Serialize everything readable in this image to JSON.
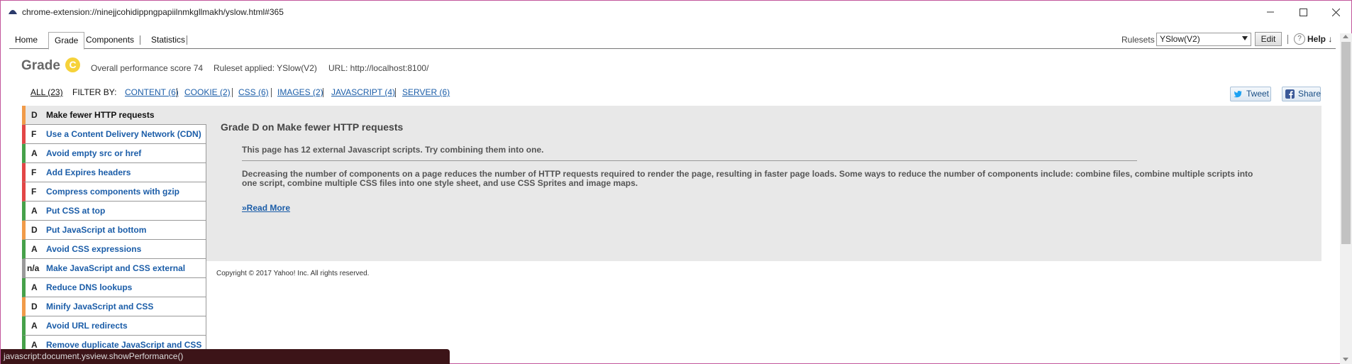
{
  "window": {
    "title": "chrome-extension://ninejjcohidippngpapiilnmkgllmakh/yslow.html#365"
  },
  "tabs": [
    {
      "label": "Home"
    },
    {
      "label": "Grade"
    },
    {
      "label": "Components"
    },
    {
      "label": "Statistics"
    }
  ],
  "toolbar": {
    "rulesets_label": "Rulesets",
    "ruleset_value": "YSlow(V2)",
    "edit_label": "Edit",
    "help_icon": "?",
    "help_label": "Help ↓"
  },
  "grade": {
    "title": "Grade",
    "letter": "C",
    "score_text": "Overall performance score 74",
    "ruleset_text": "Ruleset applied: YSlow(V2)",
    "url_text": "URL: http://localhost:8100/"
  },
  "filters": {
    "all": "ALL (23)",
    "label": "FILTER BY:",
    "items": [
      "CONTENT (6)",
      "COOKIE (2)",
      "CSS (6)",
      "IMAGES (2)",
      "JAVASCRIPT (4)",
      "SERVER (6)"
    ]
  },
  "social": {
    "tweet": "Tweet",
    "share": "Share"
  },
  "rules": [
    {
      "grade": "D",
      "name": "Make fewer HTTP requests",
      "color": "#f19b49"
    },
    {
      "grade": "F",
      "name": "Use a Content Delivery Network (CDN)",
      "color": "#e24646"
    },
    {
      "grade": "A",
      "name": "Avoid empty src or href",
      "color": "#46a14a"
    },
    {
      "grade": "F",
      "name": "Add Expires headers",
      "color": "#e24646"
    },
    {
      "grade": "F",
      "name": "Compress components with gzip",
      "color": "#e24646"
    },
    {
      "grade": "A",
      "name": "Put CSS at top",
      "color": "#46a14a"
    },
    {
      "grade": "D",
      "name": "Put JavaScript at bottom",
      "color": "#f19b49"
    },
    {
      "grade": "A",
      "name": "Avoid CSS expressions",
      "color": "#46a14a"
    },
    {
      "grade": "n/a",
      "name": "Make JavaScript and CSS external",
      "color": "#9a9a9a"
    },
    {
      "grade": "A",
      "name": "Reduce DNS lookups",
      "color": "#46a14a"
    },
    {
      "grade": "D",
      "name": "Minify JavaScript and CSS",
      "color": "#f19b49"
    },
    {
      "grade": "A",
      "name": "Avoid URL redirects",
      "color": "#46a14a"
    },
    {
      "grade": "A",
      "name": "Remove duplicate JavaScript and CSS",
      "color": "#46a14a"
    }
  ],
  "detail": {
    "title": "Grade D on Make fewer HTTP requests",
    "summary": "This page has 12 external Javascript scripts. Try combining them into one.",
    "description": "Decreasing the number of components on a page reduces the number of HTTP requests required to render the page, resulting in faster page loads. Some ways to reduce the number of components include: combine files, combine multiple scripts into one script, combine multiple CSS files into one style sheet, and use CSS Sprites and image maps.",
    "read_more": "»Read More"
  },
  "footer": {
    "copyright": "Copyright © 2017 Yahoo! Inc. All rights reserved."
  },
  "statusbar": {
    "text": "javascript:document.ysview.showPerformance()"
  },
  "colors": {
    "grade_badge": "#f6d23a",
    "link": "#1b5da8",
    "statusbar_bg": "#3c1418",
    "detail_bg": "#e8e8e8"
  }
}
